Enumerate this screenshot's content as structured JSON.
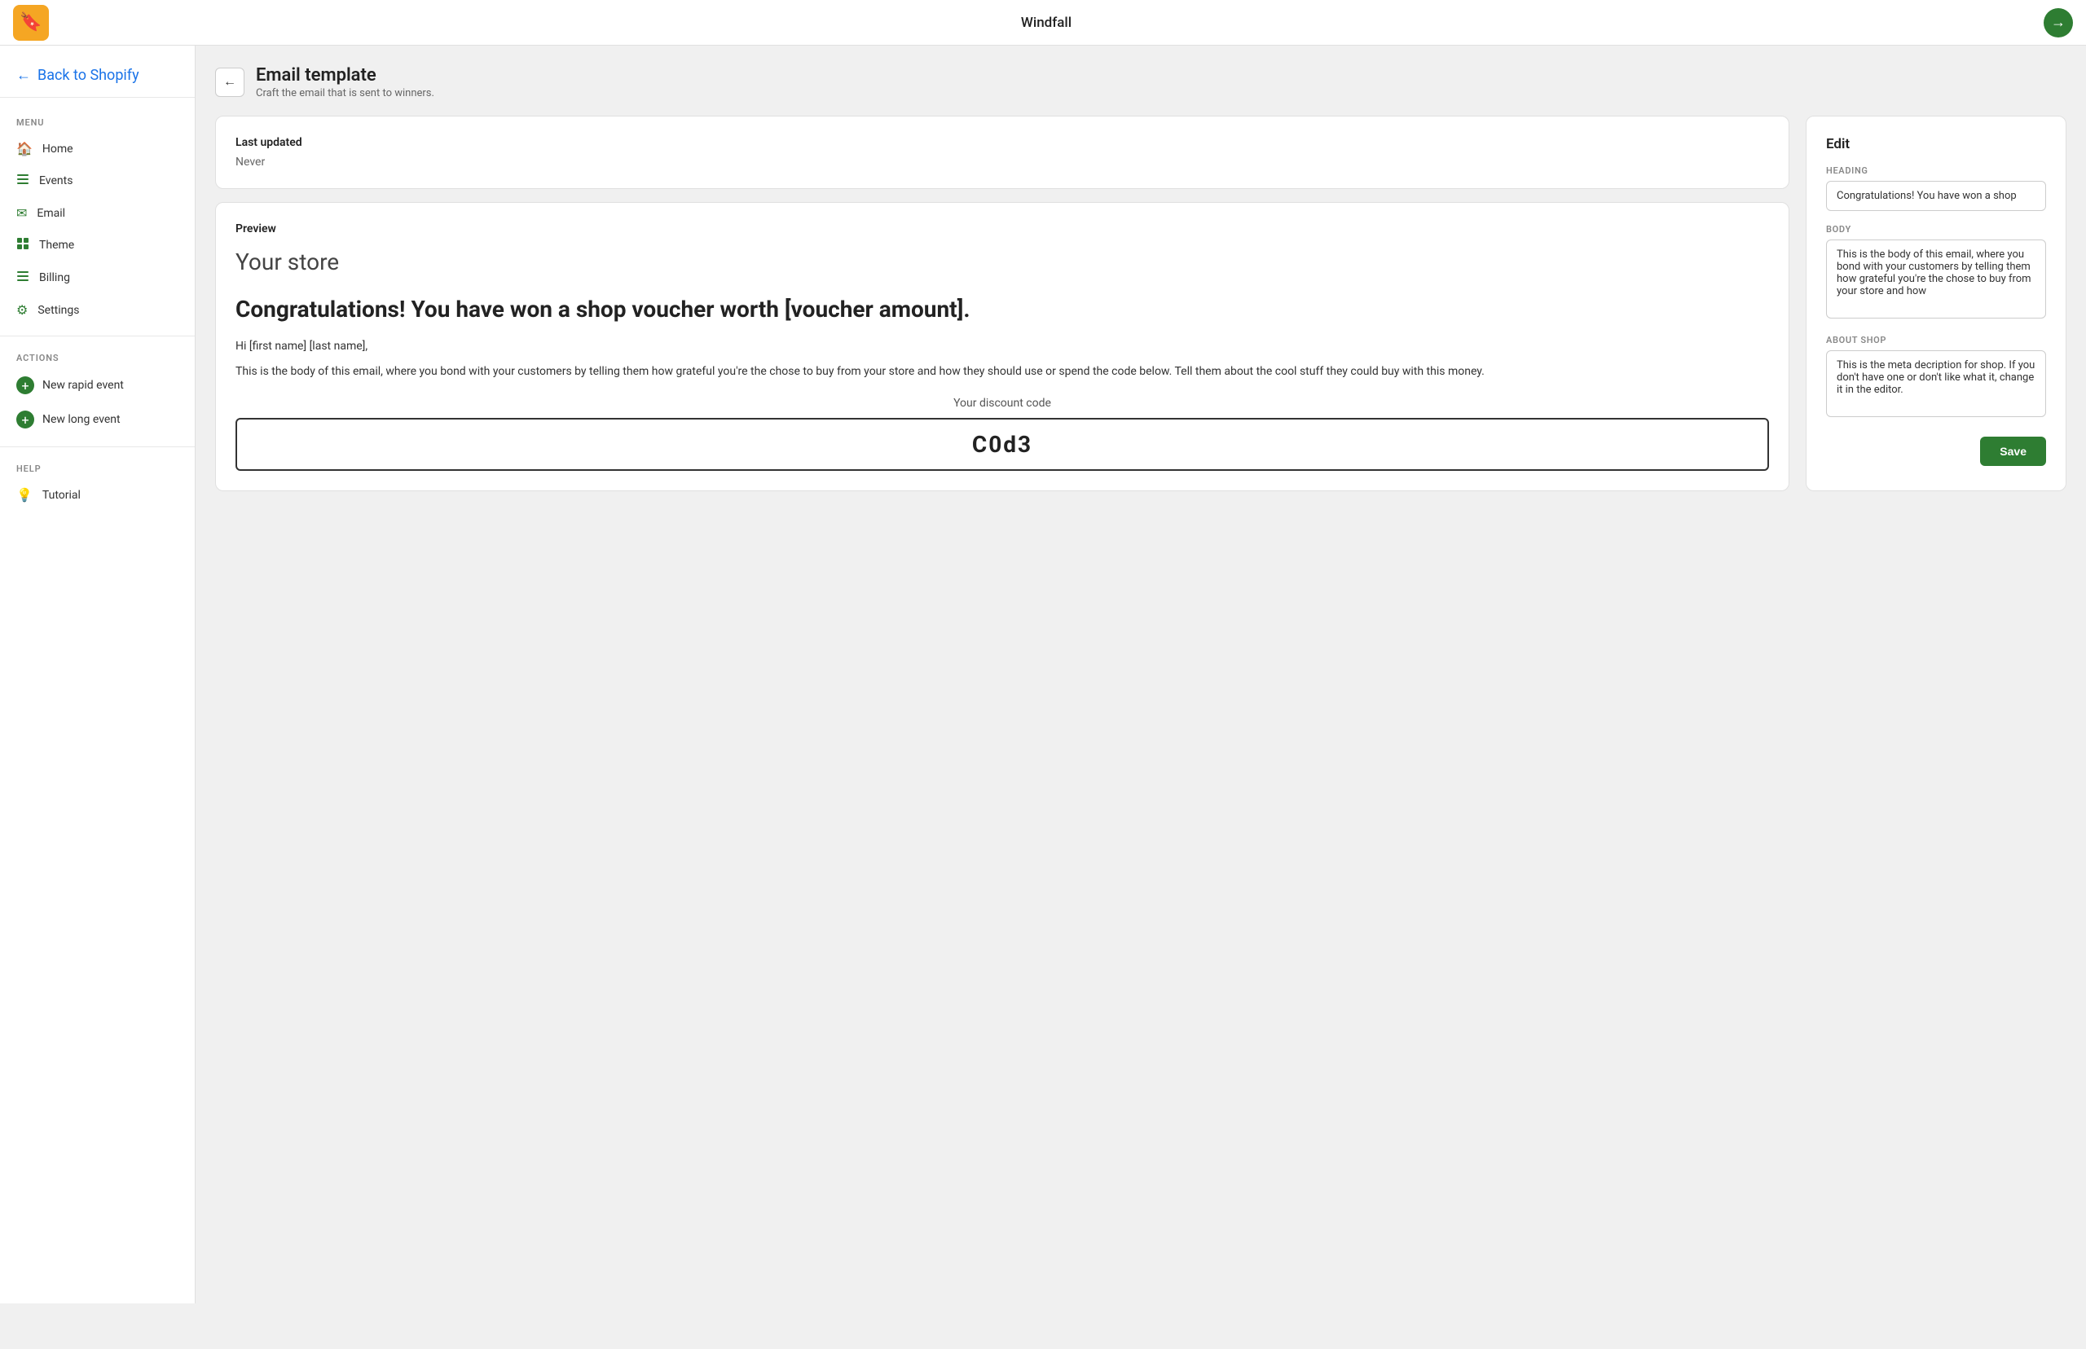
{
  "topbar": {
    "title": "Windfall",
    "logo_icon": "🔖",
    "arrow_icon": "→"
  },
  "sidebar": {
    "back_label": "Back to Shopify",
    "menu_section": "MENU",
    "menu_items": [
      {
        "id": "home",
        "label": "Home",
        "icon": "🏠"
      },
      {
        "id": "events",
        "label": "Events",
        "icon": "☰"
      },
      {
        "id": "email",
        "label": "Email",
        "icon": "✉"
      },
      {
        "id": "theme",
        "label": "Theme",
        "icon": "▪"
      },
      {
        "id": "billing",
        "label": "Billing",
        "icon": "☰"
      },
      {
        "id": "settings",
        "label": "Settings",
        "icon": "⚙"
      }
    ],
    "actions_section": "ACTIONS",
    "actions_items": [
      {
        "id": "new-rapid-event",
        "label": "New rapid event"
      },
      {
        "id": "new-long-event",
        "label": "New long event"
      }
    ],
    "help_section": "HELP",
    "help_items": [
      {
        "id": "tutorial",
        "label": "Tutorial",
        "icon": "💡"
      }
    ]
  },
  "page_header": {
    "title": "Email template",
    "subtitle": "Craft the email that is sent to winners."
  },
  "last_updated": {
    "label": "Last updated",
    "value": "Never"
  },
  "preview": {
    "label": "Preview",
    "store_name": "Your store",
    "heading": "Congratulations! You have won a shop voucher worth [voucher amount].",
    "hi_text": "Hi [first name] [last name],",
    "body_text": "This is the body of this email, where you bond with your customers by telling them how grateful you're the chose to buy from your store and how they should use or spend the code below. Tell them about the cool stuff they could buy with this money.",
    "discount_label": "Your discount code",
    "discount_code": "C0d3"
  },
  "edit": {
    "title": "Edit",
    "heading_label": "HEADING",
    "heading_value": "Congratulations! You have won a shop",
    "body_label": "BODY",
    "body_value": "This is the body of this email, where you bond with your customers by telling them how grateful you're the chose to buy from your store and how",
    "about_shop_label": "ABOUT SHOP",
    "about_shop_value": "This is the meta decription for shop. If you don't have one or don't like what it, change it in the editor.",
    "save_label": "Save"
  }
}
